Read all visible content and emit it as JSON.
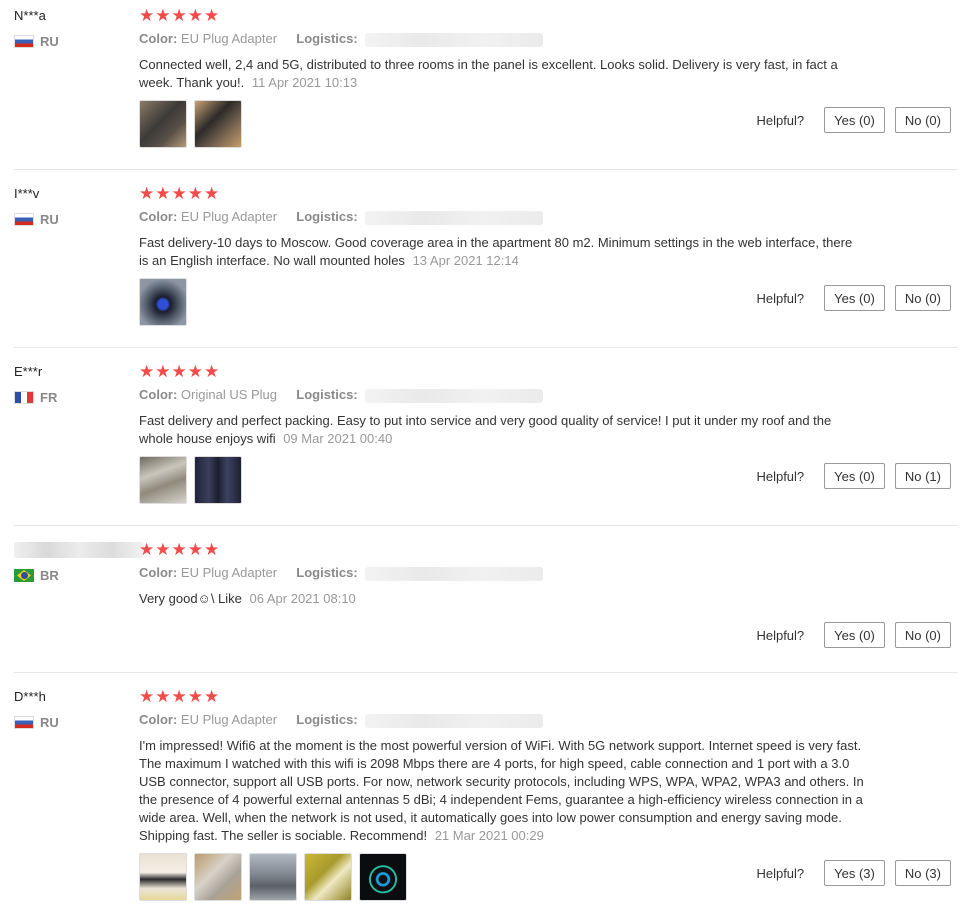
{
  "labels": {
    "color_key": "Color:",
    "logistics_key": "Logistics:",
    "helpful": "Helpful?"
  },
  "rating_stars": "★★★★★",
  "accent_color": "#f24b4b",
  "reviews": [
    {
      "user": "N***a",
      "country": "RU",
      "color": "EU Plug Adapter",
      "text": "Connected well, 2,4 and 5G, distributed to three rooms in the panel is excellent. Looks solid. Delivery is very fast, in fact a week. Thank you!.",
      "date": "11 Apr 2021 10:13",
      "yes": "Yes (0)",
      "no": "No (0)",
      "thumbs": 2
    },
    {
      "user": "I***v",
      "country": "RU",
      "color": "EU Plug Adapter",
      "text": "Fast delivery-10 days to Moscow. Good coverage area in the apartment 80 m2. Minimum settings in the web interface, there is an English interface. No wall mounted holes",
      "date": "13 Apr 2021 12:14",
      "yes": "Yes (0)",
      "no": "No (0)",
      "thumbs": 1
    },
    {
      "user": "E***r",
      "country": "FR",
      "color": "Original US Plug",
      "text": "Fast delivery and perfect packing. Easy to put into service and very good quality of service! I put it under my roof and the whole house enjoys wifi",
      "date": "09 Mar 2021 00:40",
      "yes": "Yes (0)",
      "no": "No (1)",
      "thumbs": 2
    },
    {
      "user": "",
      "country": "BR",
      "color": "EU Plug Adapter",
      "text": "Very good☺\\ Like",
      "date": "06 Apr 2021 08:10",
      "yes": "Yes (0)",
      "no": "No (0)",
      "thumbs": 0
    },
    {
      "user": "D***h",
      "country": "RU",
      "color": "EU Plug Adapter",
      "text": "I'm impressed! Wifi6 at the moment is the most powerful version of WiFi. With 5G network support. Internet speed is very fast. The maximum I watched with this wifi is 2098 Mbps there are 4 ports, for high speed, cable connection and 1 port with a 3.0 USB connector, support all USB ports. For now, network security protocols, including WPS, WPA, WPA2, WPA3 and others. In the presence of 4 powerful external antennas 5 dBi; 4 independent Fems, guarantee a high-efficiency wireless connection in a wide area. Well, when the network is not used, it automatically goes into low power consumption and energy saving mode. Shipping fast. The seller is sociable. Recommend!",
      "date": "21 Mar 2021 00:29",
      "yes": "Yes (3)",
      "no": "No (3)",
      "thumbs": 5
    }
  ]
}
